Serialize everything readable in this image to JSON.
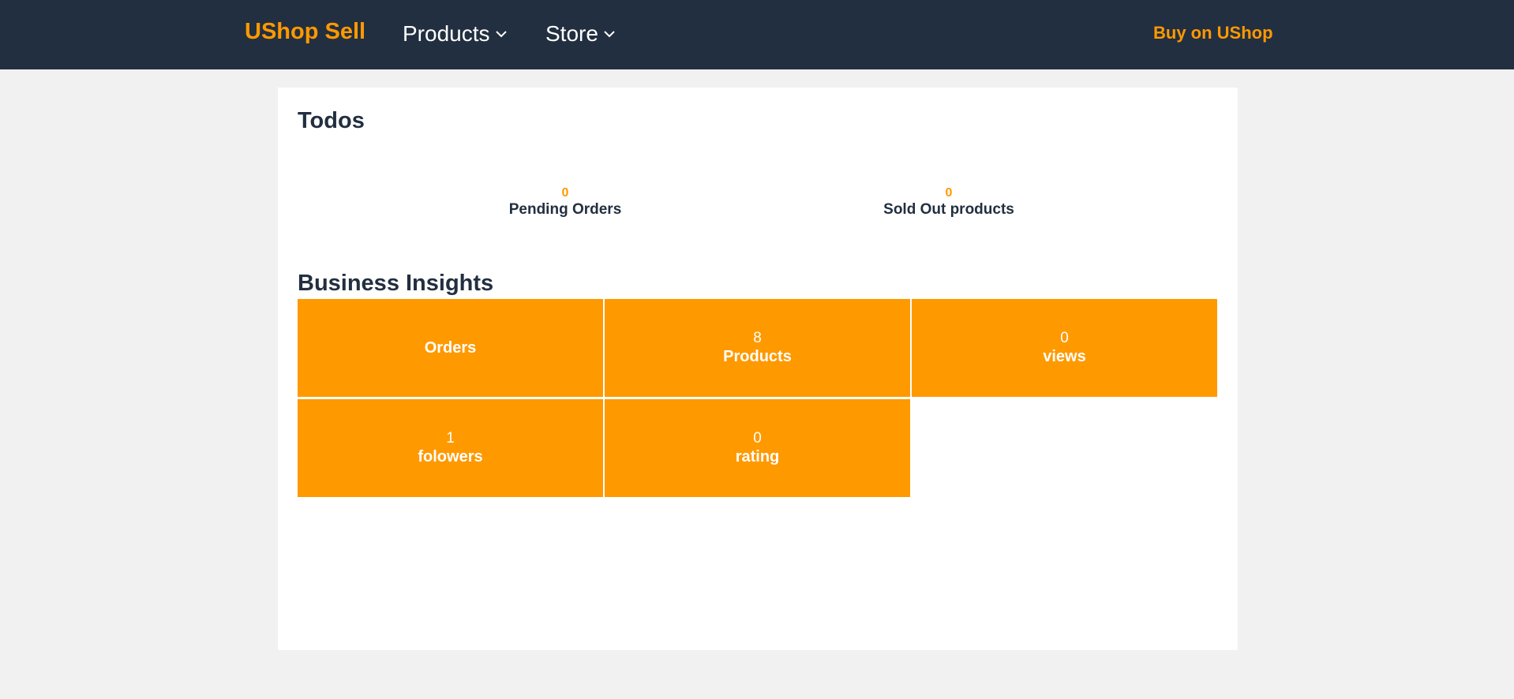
{
  "nav": {
    "brand": "UShop Sell",
    "products_label": "Products",
    "store_label": "Store",
    "buy_label": "Buy on UShop",
    "chevron_icon": "chevron-down-icon"
  },
  "todos": {
    "title": "Todos",
    "items": [
      {
        "count": "0",
        "label": "Pending Orders"
      },
      {
        "count": "0",
        "label": "Sold Out products"
      }
    ]
  },
  "insights": {
    "title": "Business Insights",
    "tiles": [
      {
        "value": "",
        "label": "Orders"
      },
      {
        "value": "8",
        "label": "Products"
      },
      {
        "value": "0",
        "label": "views"
      },
      {
        "value": "1",
        "label": "folowers"
      },
      {
        "value": "0",
        "label": "rating"
      }
    ]
  },
  "colors": {
    "navbar_bg": "#222f40",
    "accent": "#ff9900",
    "page_bg": "#f1f1f1",
    "panel_bg": "#ffffff"
  }
}
